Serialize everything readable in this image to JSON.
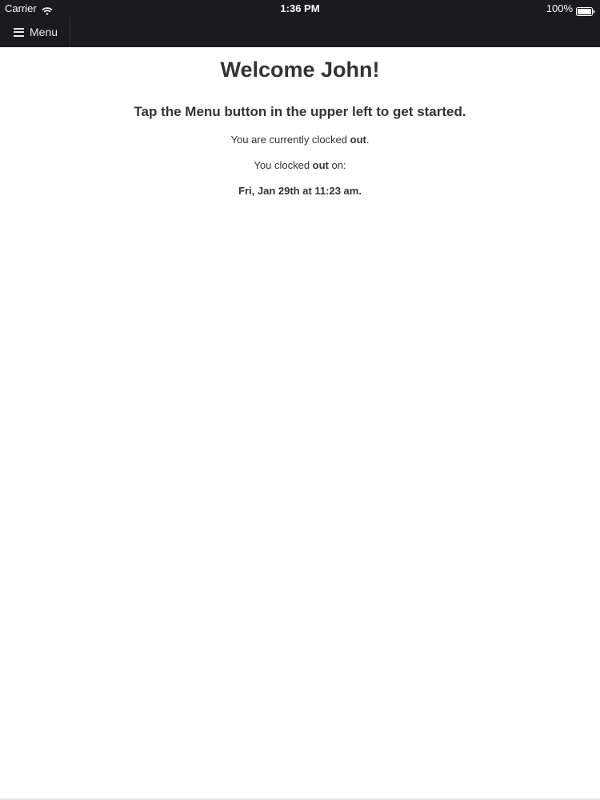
{
  "status_bar": {
    "carrier": "Carrier",
    "time": "1:36 PM",
    "battery": "100%"
  },
  "nav": {
    "menu_label": "Menu"
  },
  "main": {
    "title": "Welcome John!",
    "subtitle": "Tap the Menu button in the upper left to get started.",
    "status_prefix": "You are currently clocked ",
    "status_value": "out",
    "status_suffix": ".",
    "last_prefix": "You clocked ",
    "last_value": "out",
    "last_suffix": " on:",
    "timestamp": "Fri, Jan 29th at 11:23 am."
  },
  "colors": {
    "bar_background": "#1b1b1d",
    "text": "#333333"
  }
}
